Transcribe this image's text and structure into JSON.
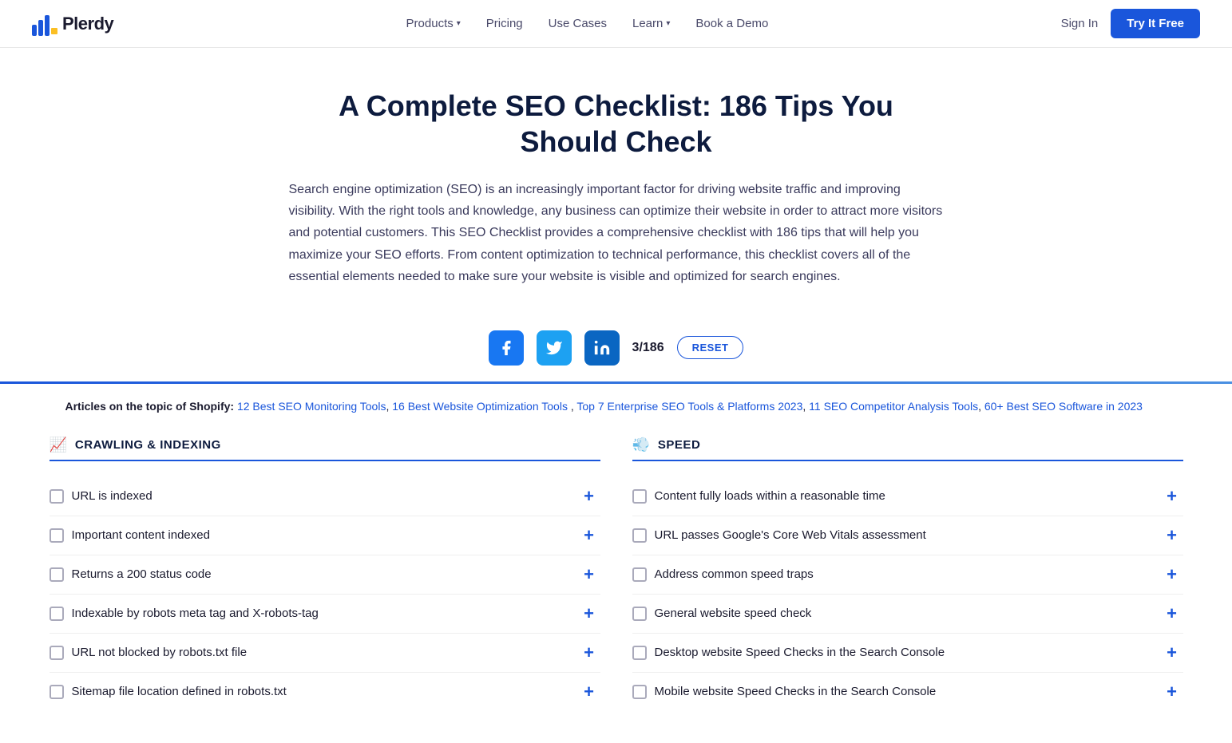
{
  "navbar": {
    "logo_text": "Plerdy",
    "nav_items": [
      {
        "label": "Products",
        "has_dropdown": true
      },
      {
        "label": "Pricing",
        "has_dropdown": false
      },
      {
        "label": "Use Cases",
        "has_dropdown": false
      },
      {
        "label": "Learn",
        "has_dropdown": true
      },
      {
        "label": "Book a Demo",
        "has_dropdown": false
      }
    ],
    "sign_in_label": "Sign In",
    "try_free_label": "Try It Free"
  },
  "hero": {
    "title": "A Complete SEO Checklist: 186 Tips You Should Check",
    "description": "Search engine optimization (SEO) is an increasingly important factor for driving website traffic and improving visibility. With the right tools and knowledge, any business can optimize their website in order to attract more visitors and potential customers. This SEO Checklist provides a comprehensive checklist with 186 tips that will help you maximize your SEO efforts. From content optimization to technical performance, this checklist covers all of the essential elements needed to make sure your website is visible and optimized for search engines."
  },
  "social_bar": {
    "counter": "3/186",
    "reset_label": "RESET"
  },
  "articles": {
    "prefix": "Articles on the topic of Shopify:",
    "links": [
      "12 Best SEO Monitoring Tools",
      "16 Best Website Optimization Tools",
      "Top 7 Enterprise SEO Tools & Platforms 2023",
      "11 SEO Competitor Analysis Tools",
      "60+ Best SEO Software in 2023"
    ]
  },
  "sections": [
    {
      "id": "crawling",
      "icon": "📈",
      "title": "CRAWLING & INDEXING",
      "items": [
        "URL is indexed",
        "Important content indexed",
        "Returns a 200 status code",
        "Indexable by robots meta tag and X-robots-tag",
        "URL not blocked by robots.txt file",
        "Sitemap file location defined in robots.txt"
      ]
    },
    {
      "id": "speed",
      "icon": "💨",
      "title": "SPEED",
      "items": [
        "Content fully loads within a reasonable time",
        "URL passes Google's Core Web Vitals assessment",
        "Address common speed traps",
        "General website speed check",
        "Desktop website Speed Checks in the Search Console",
        "Mobile website Speed Checks in the Search Console"
      ]
    }
  ],
  "colors": {
    "accent": "#1a56db",
    "text_dark": "#0d1b3e",
    "text_body": "#3a3a5c"
  }
}
